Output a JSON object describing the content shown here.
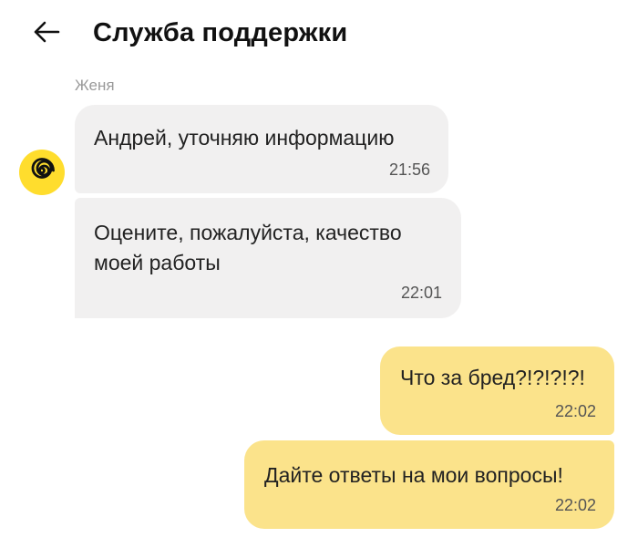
{
  "header": {
    "back_icon": "arrow-left-icon",
    "title": "Служба поддержки"
  },
  "chat": {
    "sender_name": "Женя",
    "avatar_icon": "spiral-logo-icon",
    "colors": {
      "incoming_bubble": "#f1f0f0",
      "outgoing_bubble": "#fbe38b",
      "avatar": "#ffdd2d"
    },
    "messages": [
      {
        "direction": "incoming",
        "text": "Андрей, уточняю информацию",
        "time": "21:56"
      },
      {
        "direction": "incoming",
        "text": "Оцените, пожалуйста, качество моей работы",
        "time": "22:01"
      },
      {
        "direction": "outgoing",
        "text": "Что за бред?!?!?!?!",
        "time": "22:02"
      },
      {
        "direction": "outgoing",
        "text": "Дайте ответы на мои вопросы!",
        "time": "22:02"
      }
    ]
  }
}
